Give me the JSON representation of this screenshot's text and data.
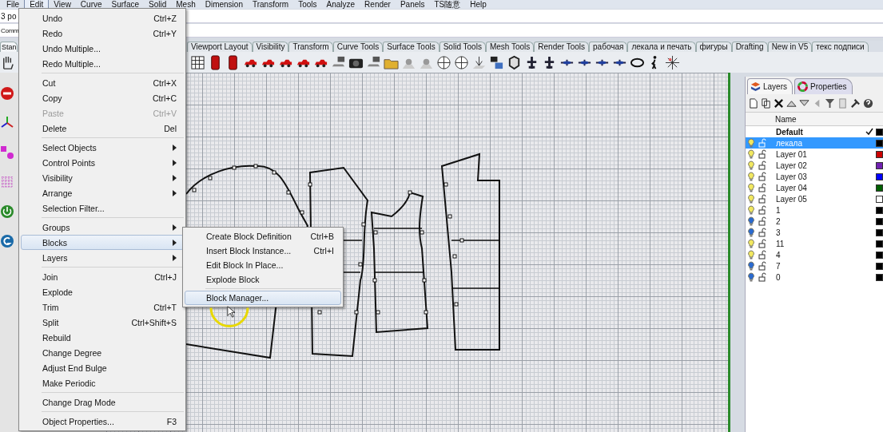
{
  "menu_bar": [
    {
      "label": "File",
      "selected": false
    },
    {
      "label": "Edit",
      "selected": true
    },
    {
      "label": "View",
      "selected": false
    },
    {
      "label": "Curve",
      "selected": false
    },
    {
      "label": "Surface",
      "selected": false
    },
    {
      "label": "Solid",
      "selected": false
    },
    {
      "label": "Mesh",
      "selected": false
    },
    {
      "label": "Dimension",
      "selected": false
    },
    {
      "label": "Transform",
      "selected": false
    },
    {
      "label": "Tools",
      "selected": false
    },
    {
      "label": "Analyze",
      "selected": false
    },
    {
      "label": "Render",
      "selected": false
    },
    {
      "label": "Panels",
      "selected": false
    },
    {
      "label": "TS随意",
      "selected": false
    },
    {
      "label": "Help",
      "selected": false
    }
  ],
  "command_history": "3 po",
  "command_prompt": "Comm",
  "toolbar_tabs": [
    {
      "label": "Stan",
      "selected": true
    },
    {
      "label": "Viewport Layout",
      "selected": false
    },
    {
      "label": "Visibility",
      "selected": false
    },
    {
      "label": "Transform",
      "selected": false
    },
    {
      "label": "Curve Tools",
      "selected": false
    },
    {
      "label": "Surface Tools",
      "selected": false
    },
    {
      "label": "Solid Tools",
      "selected": false
    },
    {
      "label": "Mesh Tools",
      "selected": false
    },
    {
      "label": "Render Tools",
      "selected": false
    },
    {
      "label": "рабочая",
      "selected": false
    },
    {
      "label": "лекала и печать",
      "selected": false
    },
    {
      "label": "фигуры",
      "selected": false
    },
    {
      "label": "Drafting",
      "selected": false
    },
    {
      "label": "New in V5",
      "selected": false
    },
    {
      "label": "текс подписи",
      "selected": false
    }
  ],
  "edit_menu": {
    "sections": [
      {
        "items": [
          {
            "label": "Undo",
            "shortcut": "Ctrl+Z",
            "submenu": false,
            "disabled": false,
            "selected": false
          },
          {
            "label": "Redo",
            "shortcut": "Ctrl+Y",
            "submenu": false,
            "disabled": false,
            "selected": false
          },
          {
            "label": "Undo Multiple...",
            "submenu": false,
            "disabled": false,
            "selected": false
          },
          {
            "label": "Redo Multiple...",
            "submenu": false,
            "disabled": false,
            "selected": false
          }
        ]
      },
      {
        "items": [
          {
            "label": "Cut",
            "shortcut": "Ctrl+X",
            "submenu": false,
            "disabled": false,
            "selected": false
          },
          {
            "label": "Copy",
            "shortcut": "Ctrl+C",
            "submenu": false,
            "disabled": false,
            "selected": false
          },
          {
            "label": "Paste",
            "shortcut": "Ctrl+V",
            "submenu": false,
            "disabled": true,
            "selected": false
          },
          {
            "label": "Delete",
            "shortcut": "Del",
            "submenu": false,
            "disabled": false,
            "selected": false
          }
        ]
      },
      {
        "items": [
          {
            "label": "Select Objects",
            "submenu": true,
            "disabled": false,
            "selected": false
          },
          {
            "label": "Control Points",
            "submenu": true,
            "disabled": false,
            "selected": false
          },
          {
            "label": "Visibility",
            "submenu": true,
            "disabled": false,
            "selected": false
          },
          {
            "label": "Arrange",
            "submenu": true,
            "disabled": false,
            "selected": false
          },
          {
            "label": "Selection Filter...",
            "submenu": false,
            "disabled": false,
            "selected": false
          }
        ]
      },
      {
        "items": [
          {
            "label": "Groups",
            "submenu": true,
            "disabled": false,
            "selected": false
          },
          {
            "label": "Blocks",
            "submenu": true,
            "disabled": false,
            "selected": true
          },
          {
            "label": "Layers",
            "submenu": true,
            "disabled": false,
            "selected": false
          }
        ]
      },
      {
        "items": [
          {
            "label": "Join",
            "shortcut": "Ctrl+J",
            "submenu": false,
            "disabled": false,
            "selected": false
          },
          {
            "label": "Explode",
            "submenu": false,
            "disabled": false,
            "selected": false
          },
          {
            "label": "Trim",
            "shortcut": "Ctrl+T",
            "submenu": false,
            "disabled": false,
            "selected": false
          },
          {
            "label": "Split",
            "shortcut": "Ctrl+Shift+S",
            "submenu": false,
            "disabled": false,
            "selected": false
          },
          {
            "label": "Rebuild",
            "submenu": false,
            "disabled": false,
            "selected": false
          },
          {
            "label": "Change Degree",
            "submenu": false,
            "disabled": false,
            "selected": false
          },
          {
            "label": "Adjust End Bulge",
            "submenu": false,
            "disabled": false,
            "selected": false
          },
          {
            "label": "Make Periodic",
            "submenu": false,
            "disabled": false,
            "selected": false
          }
        ]
      },
      {
        "items": [
          {
            "label": "Change Drag Mode",
            "submenu": false,
            "disabled": false,
            "selected": false
          }
        ]
      },
      {
        "items": [
          {
            "label": "Object Properties...",
            "shortcut": "F3",
            "submenu": false,
            "disabled": false,
            "selected": false
          }
        ]
      }
    ]
  },
  "blocks_submenu": {
    "sections": [
      {
        "items": [
          {
            "label": "Create Block Definition",
            "shortcut": "Ctrl+B",
            "selected": false
          },
          {
            "label": "Insert Block Instance...",
            "shortcut": "Ctrl+I",
            "selected": false
          },
          {
            "label": "Edit Block In Place...",
            "selected": false
          },
          {
            "label": "Explode Block",
            "selected": false
          }
        ]
      },
      {
        "items": [
          {
            "label": "Block Manager...",
            "selected": true
          }
        ]
      }
    ]
  },
  "layers_panel": {
    "tabs": [
      {
        "label": "Layers",
        "selected": true
      },
      {
        "label": "Properties",
        "selected": false
      }
    ],
    "columns": [
      "Name"
    ],
    "rows": [
      {
        "name": "Default",
        "kind": "bare",
        "current": true,
        "selected": false,
        "color": "#000000"
      },
      {
        "name": "лекала",
        "kind": "layer",
        "current": false,
        "visible": true,
        "selected": true,
        "color": "#000000"
      },
      {
        "name": "Layer 01",
        "kind": "layer",
        "current": false,
        "visible": true,
        "selected": false,
        "color": "#cc0000"
      },
      {
        "name": "Layer 02",
        "kind": "layer",
        "current": false,
        "visible": true,
        "selected": false,
        "color": "#7020b0"
      },
      {
        "name": "Layer 03",
        "kind": "layer",
        "current": false,
        "visible": true,
        "selected": false,
        "color": "#0000ff"
      },
      {
        "name": "Layer 04",
        "kind": "layer",
        "current": false,
        "visible": true,
        "selected": false,
        "color": "#006000"
      },
      {
        "name": "Layer 05",
        "kind": "layer",
        "current": false,
        "visible": true,
        "selected": false,
        "color": "#ffffff"
      },
      {
        "name": "1",
        "kind": "layer",
        "current": false,
        "visible": true,
        "selected": false,
        "color": "#000000"
      },
      {
        "name": "2",
        "kind": "layer",
        "current": false,
        "visible": false,
        "selected": false,
        "color": "#000000"
      },
      {
        "name": "3",
        "kind": "layer",
        "current": false,
        "visible": false,
        "selected": false,
        "color": "#000000"
      },
      {
        "name": "11",
        "kind": "layer",
        "current": false,
        "visible": true,
        "selected": false,
        "color": "#000000"
      },
      {
        "name": "4",
        "kind": "layer",
        "current": false,
        "visible": true,
        "selected": false,
        "color": "#000000"
      },
      {
        "name": "7",
        "kind": "layer",
        "current": false,
        "visible": false,
        "selected": false,
        "color": "#000000"
      },
      {
        "name": "0",
        "kind": "layer",
        "current": false,
        "visible": false,
        "selected": false,
        "color": "#000000"
      }
    ]
  }
}
